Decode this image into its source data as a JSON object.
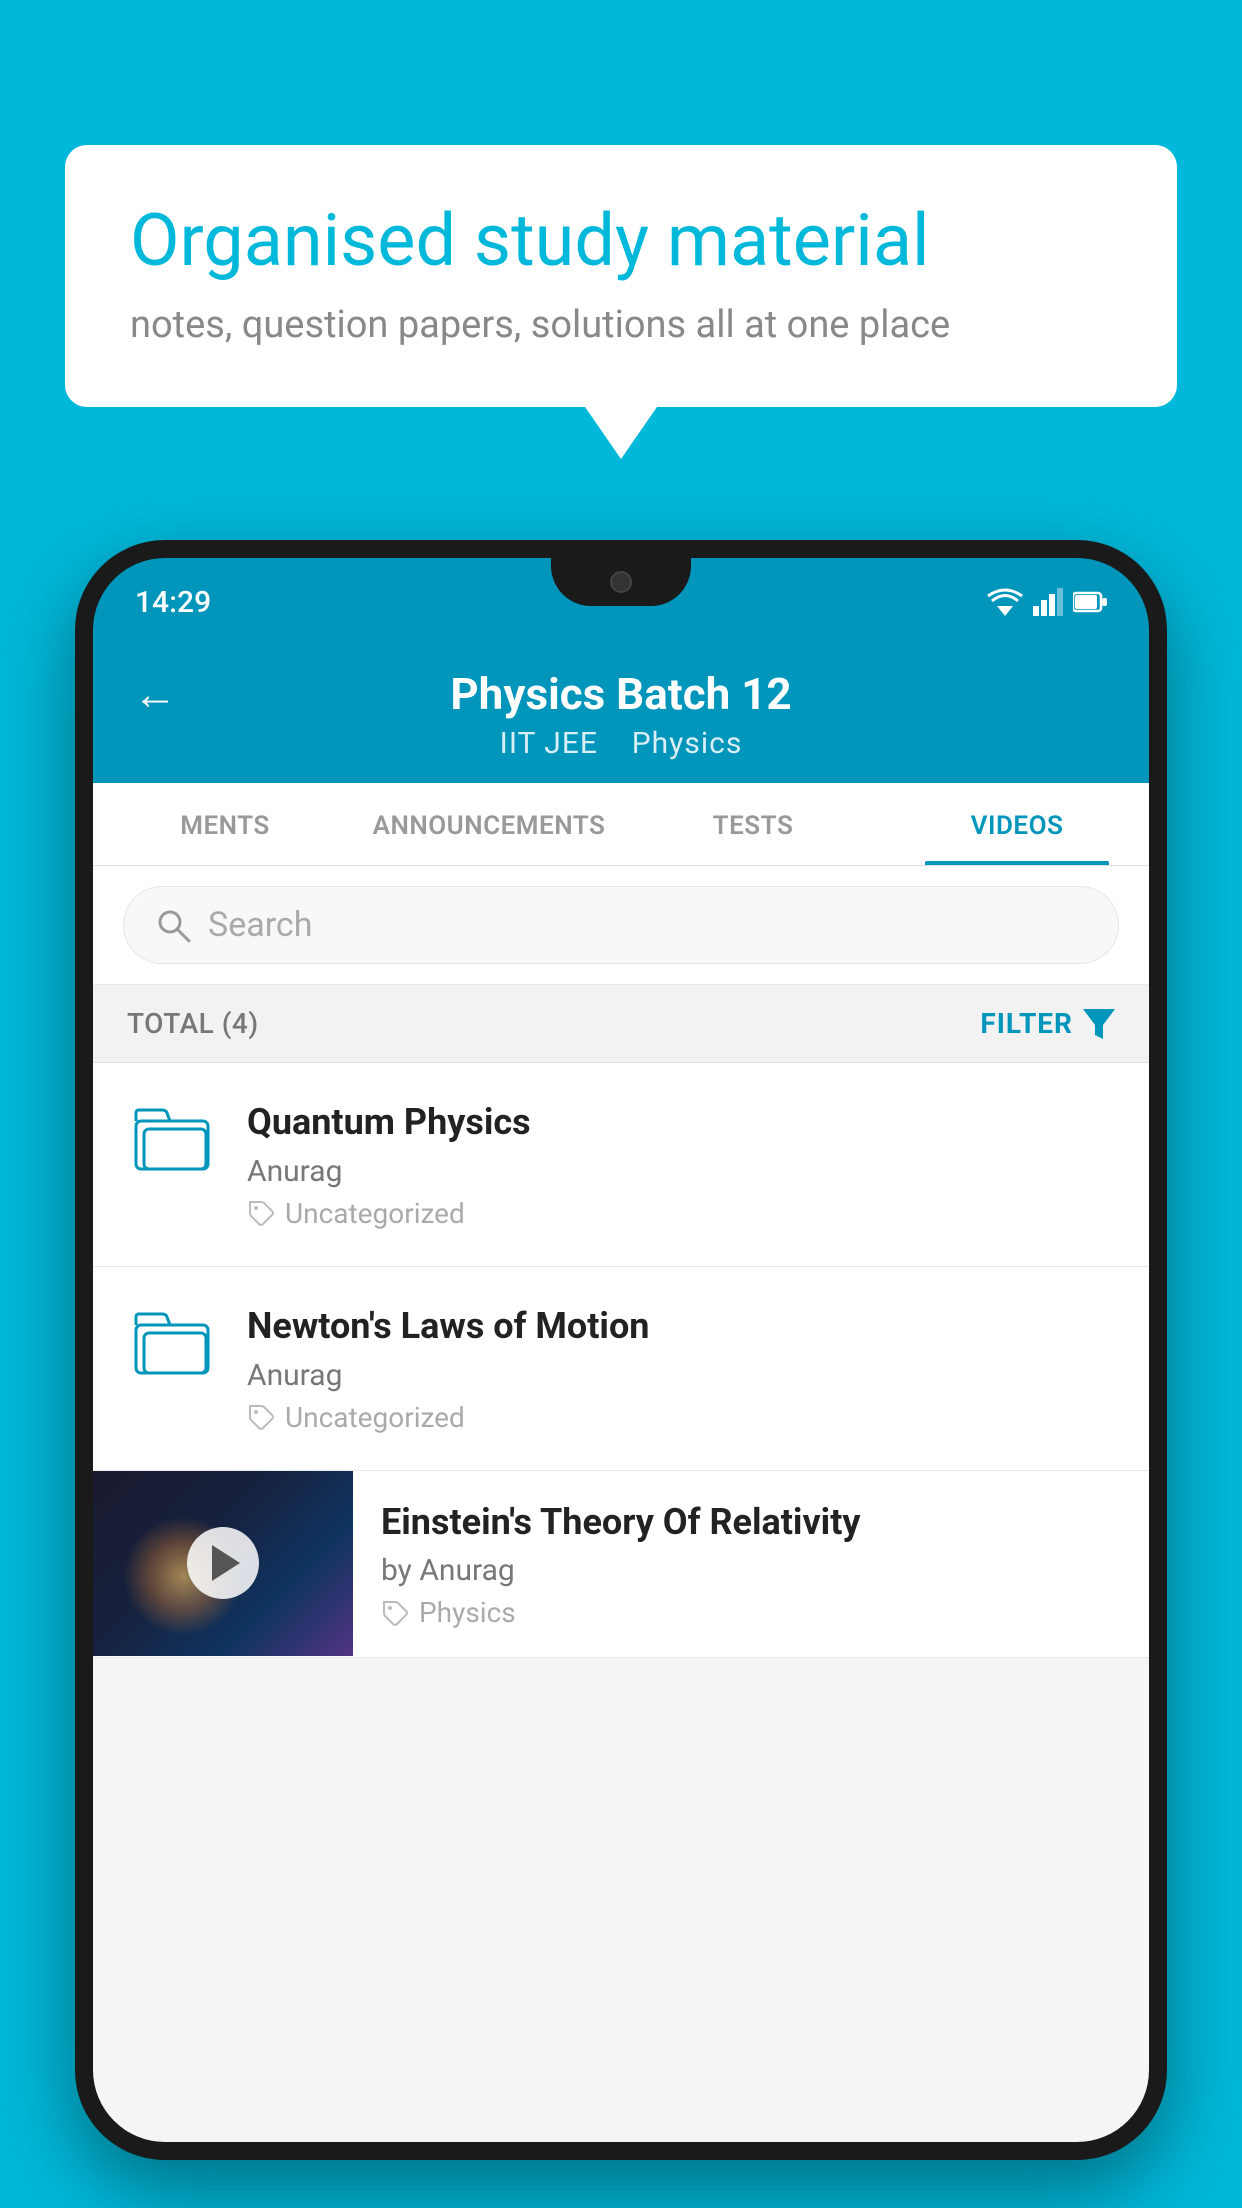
{
  "background": {
    "color": "#00b8d9"
  },
  "speech_bubble": {
    "title": "Organised study material",
    "subtitle": "notes, question papers, solutions all at one place"
  },
  "status_bar": {
    "time": "14:29",
    "icons": [
      "wifi",
      "signal",
      "battery"
    ]
  },
  "app_header": {
    "back_label": "←",
    "title": "Physics Batch 12",
    "subtitle_tags": [
      "IIT JEE",
      "Physics"
    ]
  },
  "tabs": [
    {
      "label": "MENTS",
      "active": false
    },
    {
      "label": "ANNOUNCEMENTS",
      "active": false
    },
    {
      "label": "TESTS",
      "active": false
    },
    {
      "label": "VIDEOS",
      "active": true
    }
  ],
  "search": {
    "placeholder": "Search"
  },
  "filter_bar": {
    "total_label": "TOTAL (4)",
    "filter_label": "FILTER"
  },
  "videos": [
    {
      "id": 1,
      "title": "Quantum Physics",
      "author": "Anurag",
      "tag": "Uncategorized",
      "has_thumbnail": false
    },
    {
      "id": 2,
      "title": "Newton's Laws of Motion",
      "author": "Anurag",
      "tag": "Uncategorized",
      "has_thumbnail": false
    },
    {
      "id": 3,
      "title": "Einstein's Theory Of Relativity",
      "author": "by Anurag",
      "tag": "Physics",
      "has_thumbnail": true
    }
  ]
}
